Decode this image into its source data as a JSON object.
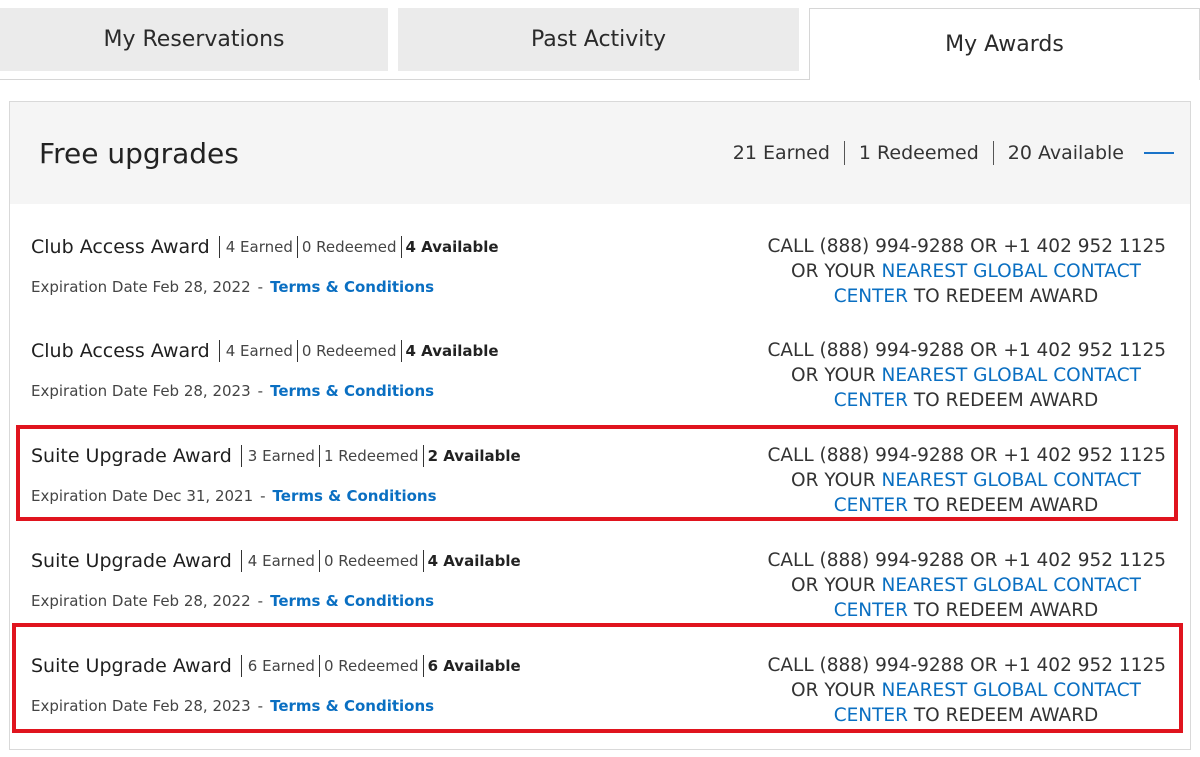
{
  "tabs": [
    {
      "label": "My Reservations"
    },
    {
      "label": "Past Activity"
    },
    {
      "label": "My Awards"
    }
  ],
  "section": {
    "title": "Free upgrades",
    "summary": {
      "earned": "21 Earned",
      "redeemed": "1 Redeemed",
      "available": "20 Available"
    }
  },
  "awards": [
    {
      "name": "Club Access Award",
      "earned": "4 Earned",
      "redeemed": "0 Redeemed",
      "available": "4 Available",
      "expiration": "Expiration Date Feb 28, 2022",
      "terms": "Terms & Conditions"
    },
    {
      "name": "Club Access Award",
      "earned": "4 Earned",
      "redeemed": "0 Redeemed",
      "available": "4 Available",
      "expiration": "Expiration Date Feb 28, 2023",
      "terms": "Terms & Conditions"
    },
    {
      "name": "Suite Upgrade Award",
      "earned": "3 Earned",
      "redeemed": "1 Redeemed",
      "available": "2 Available",
      "expiration": "Expiration Date Dec 31, 2021",
      "terms": "Terms & Conditions"
    },
    {
      "name": "Suite Upgrade Award",
      "earned": "4 Earned",
      "redeemed": "0 Redeemed",
      "available": "4 Available",
      "expiration": "Expiration Date Feb 28, 2022",
      "terms": "Terms & Conditions"
    },
    {
      "name": "Suite Upgrade Award",
      "earned": "6 Earned",
      "redeemed": "0 Redeemed",
      "available": "6 Available",
      "expiration": "Expiration Date Feb 28, 2023",
      "terms": "Terms & Conditions"
    }
  ],
  "redeem": {
    "call": "CALL (888) 994-9288 OR +1 402 952 1125",
    "or_your": "OR YOUR ",
    "link_1": "NEAREST GLOBAL CONTACT",
    "link_2": "CENTER",
    "to_redeem": " TO REDEEM AWARD"
  },
  "colors": {
    "link": "#0a6fc2",
    "highlight": "#e0141e"
  }
}
